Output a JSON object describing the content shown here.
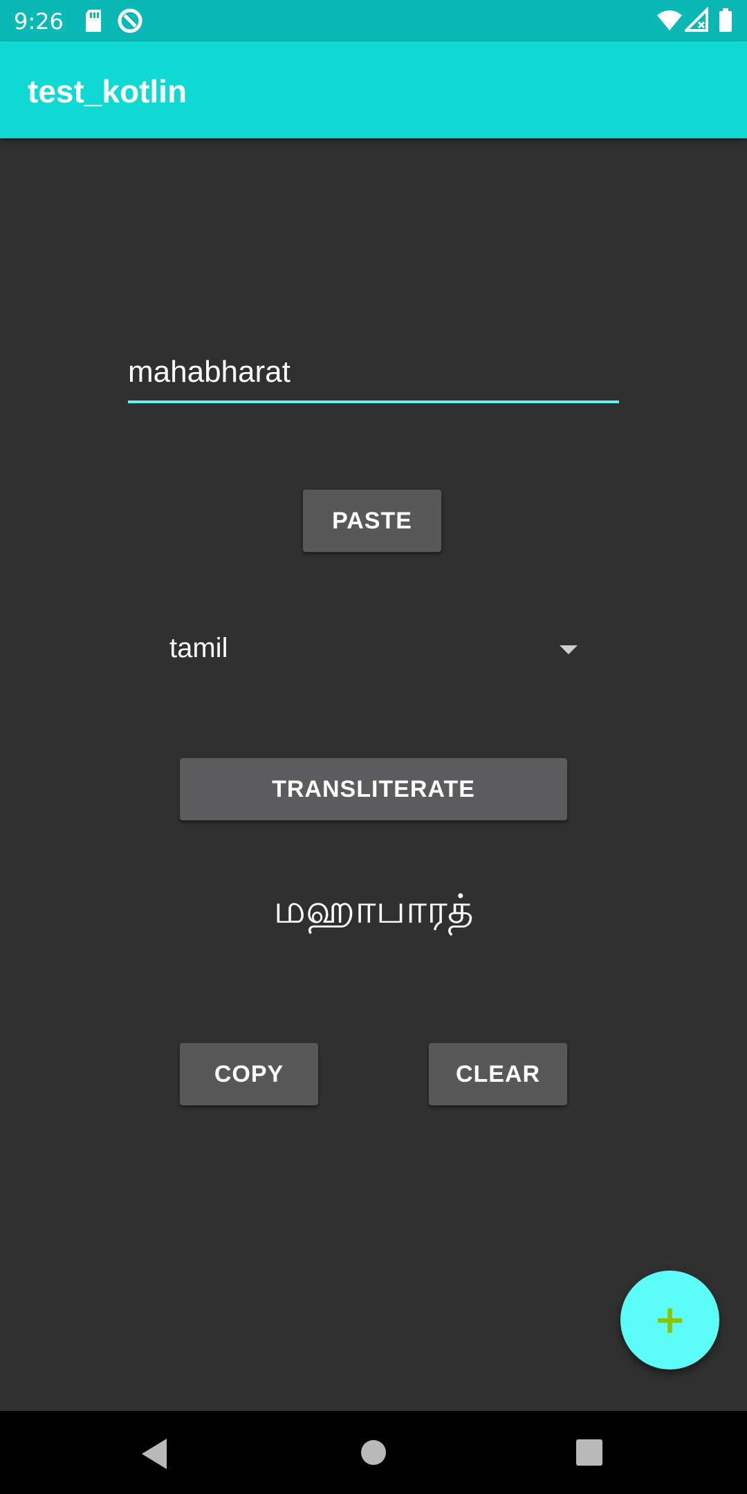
{
  "status_bar": {
    "time": "9:26",
    "icons": [
      "sd-card-icon",
      "data-saver-icon",
      "wifi-icon",
      "signal-icon",
      "battery-icon"
    ]
  },
  "app_bar": {
    "title": "test_kotlin"
  },
  "input": {
    "value": "mahabharat"
  },
  "buttons": {
    "paste": "PASTE",
    "transliterate": "TRANSLITERATE",
    "copy": "COPY",
    "clear": "CLEAR"
  },
  "spinner": {
    "selected": "tamil"
  },
  "output": {
    "text": "மஹாபாரத்"
  },
  "fab": {
    "icon": "plus-icon",
    "label": "+"
  },
  "colors": {
    "status_bar": "#0ab8b6",
    "app_bar": "#10d9d3",
    "background": "#303030",
    "accent": "#5cf5f0",
    "fab": "#5cfcf8",
    "fab_icon": "#8bc400"
  },
  "nav_bar": {
    "icons": [
      "back-icon",
      "home-icon",
      "recents-icon"
    ]
  }
}
